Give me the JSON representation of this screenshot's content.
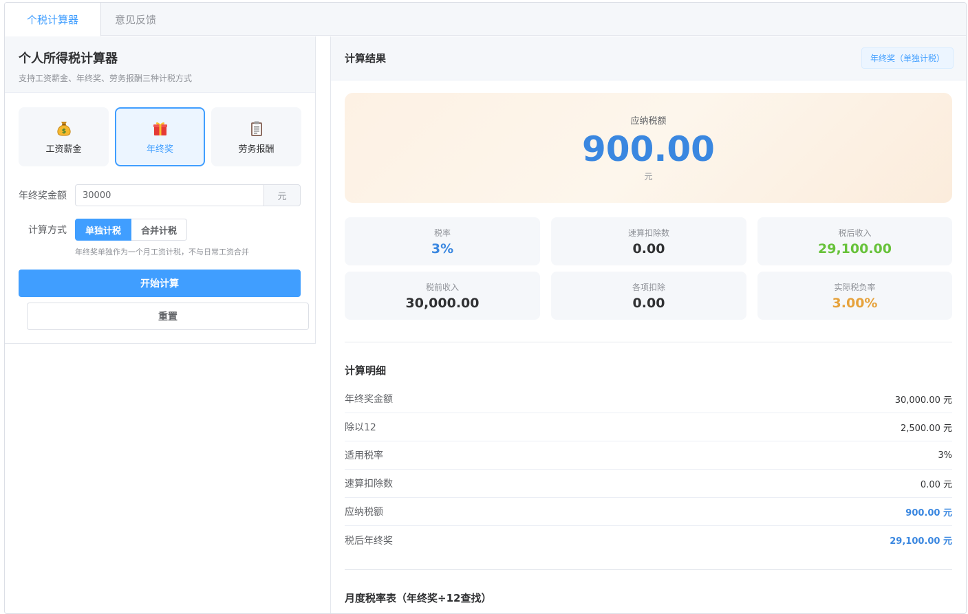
{
  "tabs": [
    {
      "label": "个税计算器",
      "active": true
    },
    {
      "label": "意见反馈",
      "active": false
    }
  ],
  "left": {
    "title": "个人所得税计算器",
    "subtitle": "支持工资薪金、年终奖、劳务报酬三种计税方式",
    "modes": [
      {
        "label": "工资薪金",
        "icon": "money-bag-icon"
      },
      {
        "label": "年终奖",
        "icon": "gift-icon",
        "active": true
      },
      {
        "label": "劳务报酬",
        "icon": "clipboard-icon"
      }
    ],
    "amount": {
      "label": "年终奖金额",
      "value": "30000",
      "unit": "元"
    },
    "method": {
      "label": "计算方式",
      "options": [
        "单独计税",
        "合并计税"
      ],
      "selected": "单独计税",
      "hint": "年终奖单独作为一个月工资计税，不与日常工资合并"
    },
    "start_label": "开始计算",
    "reset_label": "重置"
  },
  "right": {
    "title": "计算结果",
    "mode_tag": "年终奖（单独计税）",
    "hero": {
      "label": "应纳税额",
      "value": "900.00",
      "unit": "元"
    },
    "stats": [
      {
        "label": "税率",
        "value": "3%",
        "color": "#3a87e0"
      },
      {
        "label": "速算扣除数",
        "value": "0.00",
        "color": "#303133"
      },
      {
        "label": "税后收入",
        "value": "29,100.00",
        "color": "#67c23a"
      },
      {
        "label": "税前收入",
        "value": "30,000.00",
        "color": "#303133"
      },
      {
        "label": "各项扣除",
        "value": "0.00",
        "color": "#303133"
      },
      {
        "label": "实际税负率",
        "value": "3.00%",
        "color": "#e6a23c"
      }
    ],
    "detail_title": "计算明细",
    "details": [
      {
        "label": "年终奖金额",
        "value": "30,000.00 元",
        "highlight": false
      },
      {
        "label": "除以12",
        "value": "2,500.00 元",
        "highlight": false
      },
      {
        "label": "适用税率",
        "value": "3%",
        "highlight": false
      },
      {
        "label": "速算扣除数",
        "value": "0.00 元",
        "highlight": false
      },
      {
        "label": "应纳税额",
        "value": "900.00 元",
        "highlight": true
      },
      {
        "label": "税后年终奖",
        "value": "29,100.00 元",
        "highlight": true
      }
    ],
    "table_title": "月度税率表（年终奖÷12查找）"
  }
}
